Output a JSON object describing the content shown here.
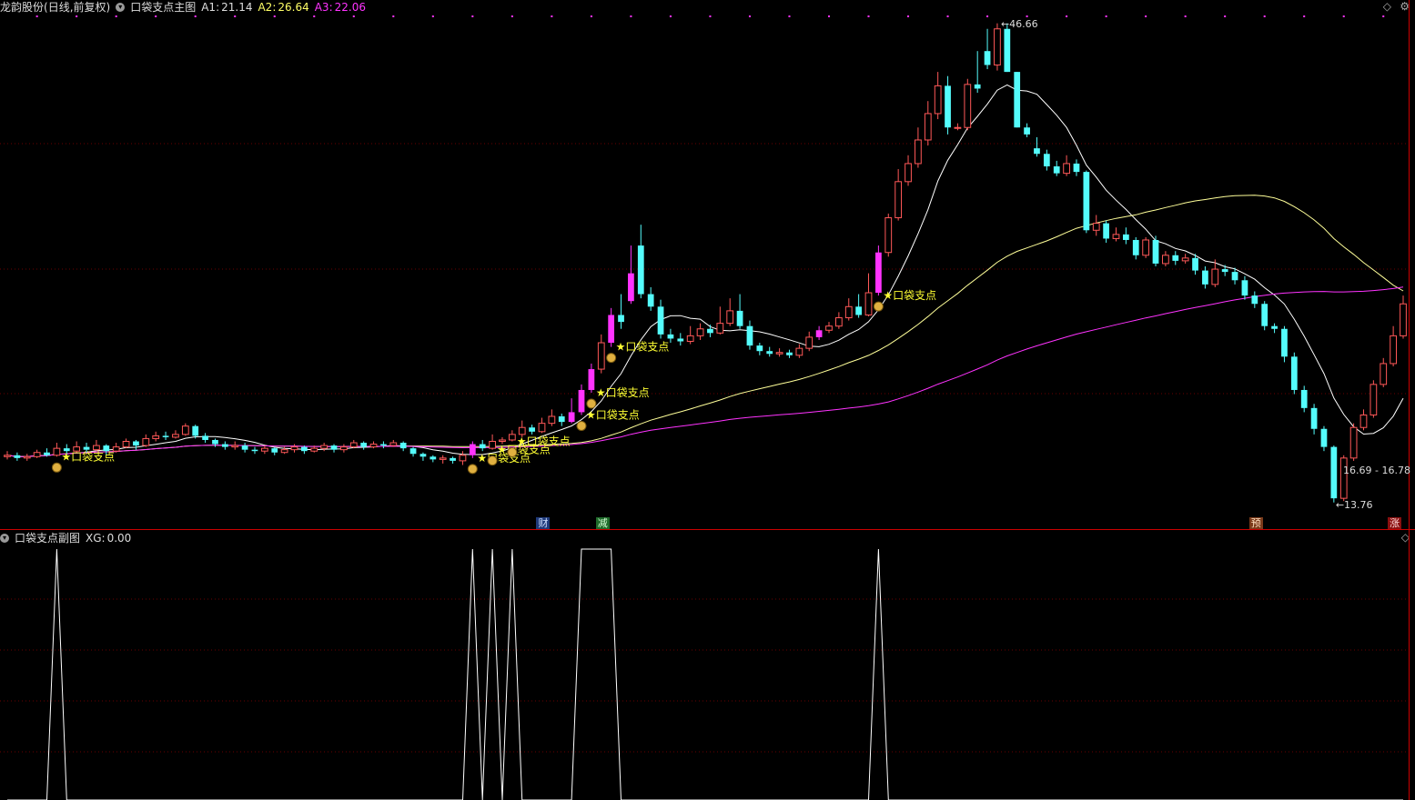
{
  "header": {
    "stock": "龙韵股份",
    "mode": "(日线,前复权)",
    "indicator": "口袋支点主图",
    "a1_label": "A1:",
    "a1_value": "21.14",
    "a2_label": "A2:",
    "a2_value": "26.64",
    "a3_label": "A3:",
    "a3_value": "22.06"
  },
  "sub_header": {
    "indicator": "口袋支点副图",
    "xg_label": "XG:",
    "xg_value": "0.00"
  },
  "colors": {
    "up": "#ff5858",
    "down": "#54fcfc",
    "pocket": "#ff33ff",
    "ma_short": "#ffffff",
    "ma_mid": "#ffff99",
    "ma_long": "#ff33ff",
    "signal": "#ffff33",
    "grid": "#6a0000",
    "axis": "#cc0000"
  },
  "icons": {
    "dropdown": "chevron-down-icon",
    "diamond": "diamond-icon",
    "gear": "gear-icon"
  },
  "price_labels": {
    "high": "46.66",
    "low": "13.76",
    "range": "16.69 - 16.78"
  },
  "signal_label": "★口袋支点",
  "event_tags": [
    {
      "text": "财",
      "bg": "#1f3a7a",
      "fg": "#cfe0ff"
    },
    {
      "text": "减",
      "bg": "#1f6a2a",
      "fg": "#d6ffd6"
    },
    {
      "text": "预",
      "bg": "#7a3a1a",
      "fg": "#ffe0c0"
    },
    {
      "text": "涨",
      "bg": "#8a1010",
      "fg": "#ffdada"
    }
  ],
  "chart_data": {
    "type": "candlestick",
    "price_range": [
      12.5,
      48.5
    ],
    "candles": [
      [
        16.8,
        16.9,
        17.2,
        16.6
      ],
      [
        16.9,
        16.7,
        17.1,
        16.5
      ],
      [
        16.7,
        16.8,
        17.0,
        16.5
      ],
      [
        16.8,
        17.1,
        17.3,
        16.7
      ],
      [
        17.1,
        16.9,
        17.4,
        16.8
      ],
      [
        16.9,
        17.4,
        17.8,
        16.8
      ],
      [
        17.4,
        17.2,
        17.7,
        17.0
      ],
      [
        17.2,
        17.5,
        17.9,
        17.1
      ],
      [
        17.5,
        17.3,
        17.8,
        17.1
      ],
      [
        17.3,
        17.6,
        18.0,
        17.2
      ],
      [
        17.6,
        17.2,
        17.7,
        16.9
      ],
      [
        17.2,
        17.5,
        17.8,
        17.1
      ],
      [
        17.5,
        17.9,
        18.1,
        17.4
      ],
      [
        17.9,
        17.6,
        18.0,
        17.3
      ],
      [
        17.6,
        18.1,
        18.4,
        17.5
      ],
      [
        18.1,
        18.3,
        18.6,
        17.9
      ],
      [
        18.3,
        18.2,
        18.6,
        18.0
      ],
      [
        18.2,
        18.4,
        18.7,
        18.1
      ],
      [
        18.4,
        19.0,
        19.2,
        18.3
      ],
      [
        19.0,
        18.3,
        19.1,
        18.1
      ],
      [
        18.3,
        18.0,
        18.5,
        17.8
      ],
      [
        18.0,
        17.7,
        18.1,
        17.5
      ],
      [
        17.7,
        17.5,
        17.9,
        17.3
      ],
      [
        17.5,
        17.6,
        17.9,
        17.3
      ],
      [
        17.6,
        17.3,
        17.8,
        17.1
      ],
      [
        17.3,
        17.2,
        17.5,
        17.0
      ],
      [
        17.2,
        17.4,
        17.6,
        17.0
      ],
      [
        17.4,
        17.1,
        17.5,
        16.9
      ],
      [
        17.1,
        17.3,
        17.5,
        17.0
      ],
      [
        17.3,
        17.5,
        17.7,
        17.1
      ],
      [
        17.5,
        17.2,
        17.6,
        17.0
      ],
      [
        17.2,
        17.4,
        17.6,
        17.1
      ],
      [
        17.4,
        17.6,
        17.8,
        17.2
      ],
      [
        17.6,
        17.3,
        17.7,
        17.1
      ],
      [
        17.3,
        17.5,
        17.7,
        17.1
      ],
      [
        17.5,
        17.8,
        18.0,
        17.4
      ],
      [
        17.8,
        17.5,
        17.9,
        17.3
      ],
      [
        17.5,
        17.7,
        17.9,
        17.4
      ],
      [
        17.7,
        17.6,
        17.9,
        17.4
      ],
      [
        17.6,
        17.8,
        18.0,
        17.5
      ],
      [
        17.8,
        17.4,
        17.9,
        17.2
      ],
      [
        17.4,
        17.0,
        17.5,
        16.8
      ],
      [
        17.0,
        16.8,
        17.1,
        16.5
      ],
      [
        16.8,
        16.6,
        16.9,
        16.4
      ],
      [
        16.6,
        16.7,
        16.9,
        16.3
      ],
      [
        16.7,
        16.5,
        16.8,
        16.3
      ],
      [
        16.5,
        16.9,
        17.2,
        16.2
      ],
      [
        16.9,
        17.7,
        17.9,
        16.7
      ],
      [
        17.7,
        17.4,
        18.0,
        17.2
      ],
      [
        17.4,
        17.9,
        18.4,
        17.3
      ],
      [
        17.9,
        18.0,
        18.2,
        17.7
      ],
      [
        18.0,
        18.4,
        18.7,
        17.9
      ],
      [
        18.4,
        18.9,
        19.4,
        18.2
      ],
      [
        18.9,
        18.6,
        19.1,
        18.4
      ],
      [
        18.6,
        19.2,
        19.6,
        18.5
      ],
      [
        19.2,
        19.7,
        20.2,
        19.0
      ],
      [
        19.7,
        19.3,
        19.9,
        19.0
      ],
      [
        19.3,
        20.0,
        21.0,
        19.2
      ],
      [
        20.0,
        21.6,
        22.0,
        19.8
      ],
      [
        21.6,
        23.1,
        23.5,
        21.4
      ],
      [
        23.1,
        25.0,
        25.6,
        22.8
      ],
      [
        25.0,
        27.0,
        27.5,
        24.7
      ],
      [
        27.0,
        26.5,
        28.5,
        26.0
      ],
      [
        28.0,
        30.0,
        32.0,
        27.8
      ],
      [
        32.0,
        28.5,
        33.5,
        28.2
      ],
      [
        28.5,
        27.6,
        29.0,
        27.3
      ],
      [
        27.6,
        25.6,
        28.1,
        25.3
      ],
      [
        25.6,
        25.3,
        26.0,
        25.0
      ],
      [
        25.3,
        25.1,
        25.7,
        24.8
      ],
      [
        25.1,
        25.5,
        26.2,
        24.9
      ],
      [
        25.5,
        26.0,
        26.4,
        25.2
      ],
      [
        26.0,
        25.7,
        26.3,
        25.4
      ],
      [
        25.7,
        26.4,
        27.6,
        25.6
      ],
      [
        26.4,
        27.3,
        28.2,
        26.2
      ],
      [
        27.3,
        26.2,
        28.5,
        26.0
      ],
      [
        26.2,
        24.8,
        26.6,
        24.5
      ],
      [
        24.8,
        24.4,
        25.0,
        24.1
      ],
      [
        24.4,
        24.2,
        24.7,
        24.0
      ],
      [
        24.2,
        24.3,
        24.6,
        24.0
      ],
      [
        24.3,
        24.1,
        24.5,
        23.9
      ],
      [
        24.1,
        24.6,
        24.9,
        23.9
      ],
      [
        24.6,
        25.4,
        25.8,
        24.4
      ],
      [
        25.4,
        25.9,
        26.2,
        25.2
      ],
      [
        25.9,
        26.2,
        26.5,
        25.7
      ],
      [
        26.2,
        26.8,
        27.2,
        26.0
      ],
      [
        26.8,
        27.6,
        28.2,
        26.6
      ],
      [
        27.6,
        27.0,
        28.5,
        26.8
      ],
      [
        27.0,
        28.6,
        30.0,
        26.9
      ],
      [
        28.6,
        31.5,
        32.0,
        28.4
      ],
      [
        31.5,
        34.0,
        34.3,
        31.2
      ],
      [
        34.0,
        36.6,
        37.5,
        33.8
      ],
      [
        36.6,
        37.9,
        38.5,
        36.3
      ],
      [
        37.9,
        39.6,
        40.5,
        37.6
      ],
      [
        39.6,
        41.5,
        42.4,
        39.2
      ],
      [
        41.5,
        43.5,
        44.5,
        41.1
      ],
      [
        43.5,
        40.5,
        44.2,
        40.0
      ],
      [
        40.5,
        40.5,
        40.8,
        40.3
      ],
      [
        40.5,
        43.6,
        44.0,
        40.3
      ],
      [
        43.6,
        43.3,
        46.0,
        43.0
      ],
      [
        46.0,
        45.0,
        47.6,
        44.7
      ],
      [
        45.0,
        47.6,
        48.0,
        44.6
      ],
      [
        47.6,
        44.5,
        48.0,
        44.5
      ],
      [
        44.5,
        40.5,
        44.5,
        40.5
      ],
      [
        40.5,
        40.0,
        40.8,
        39.8
      ],
      [
        39.0,
        38.6,
        39.8,
        38.4
      ],
      [
        38.6,
        37.7,
        38.9,
        37.4
      ],
      [
        37.7,
        37.2,
        38.1,
        37.0
      ],
      [
        37.2,
        37.9,
        38.5,
        37.0
      ],
      [
        37.9,
        37.3,
        38.2,
        37.0
      ],
      [
        37.3,
        33.1,
        37.4,
        32.9
      ],
      [
        33.1,
        33.6,
        34.2,
        32.7
      ],
      [
        33.6,
        32.5,
        33.8,
        32.2
      ],
      [
        32.5,
        32.8,
        33.3,
        32.3
      ],
      [
        32.8,
        32.4,
        33.3,
        32.1
      ],
      [
        32.4,
        31.3,
        32.6,
        31.0
      ],
      [
        31.3,
        32.4,
        32.6,
        31.1
      ],
      [
        32.4,
        30.7,
        32.7,
        30.5
      ],
      [
        30.7,
        31.3,
        31.6,
        30.5
      ],
      [
        31.3,
        30.9,
        31.6,
        30.6
      ],
      [
        30.9,
        31.1,
        31.4,
        30.7
      ],
      [
        31.1,
        30.2,
        31.4,
        29.9
      ],
      [
        30.2,
        29.2,
        30.5,
        28.9
      ],
      [
        29.2,
        30.3,
        31.0,
        29.0
      ],
      [
        30.3,
        30.1,
        30.6,
        29.8
      ],
      [
        30.1,
        29.5,
        30.4,
        29.2
      ],
      [
        29.5,
        28.4,
        29.8,
        28.1
      ],
      [
        28.4,
        27.8,
        28.7,
        27.5
      ],
      [
        27.8,
        26.2,
        28.0,
        25.9
      ],
      [
        26.2,
        26.0,
        26.4,
        25.7
      ],
      [
        26.0,
        24.0,
        26.2,
        23.6
      ],
      [
        24.0,
        21.6,
        24.3,
        21.3
      ],
      [
        21.6,
        20.3,
        21.9,
        20.0
      ],
      [
        20.3,
        18.8,
        20.6,
        18.4
      ],
      [
        18.8,
        17.5,
        19.0,
        17.2
      ],
      [
        17.5,
        13.8,
        17.6,
        13.5
      ],
      [
        13.8,
        16.7,
        16.9,
        13.6
      ],
      [
        16.7,
        18.9,
        19.2,
        16.5
      ],
      [
        18.9,
        19.8,
        20.2,
        18.7
      ],
      [
        19.8,
        22.0,
        22.3,
        19.6
      ],
      [
        22.0,
        23.5,
        23.9,
        21.8
      ],
      [
        23.5,
        25.5,
        26.2,
        23.3
      ],
      [
        25.5,
        27.8,
        28.4,
        25.3
      ]
    ],
    "pocket_days": [
      47,
      57,
      58,
      59,
      61,
      63,
      82,
      88
    ],
    "signal_days": [
      5,
      47,
      49,
      51,
      58,
      59,
      61,
      88
    ],
    "xg_days": [
      5,
      47,
      49,
      51,
      58,
      59,
      60,
      61,
      88
    ],
    "event_days": [
      54,
      60,
      126,
      140
    ]
  }
}
